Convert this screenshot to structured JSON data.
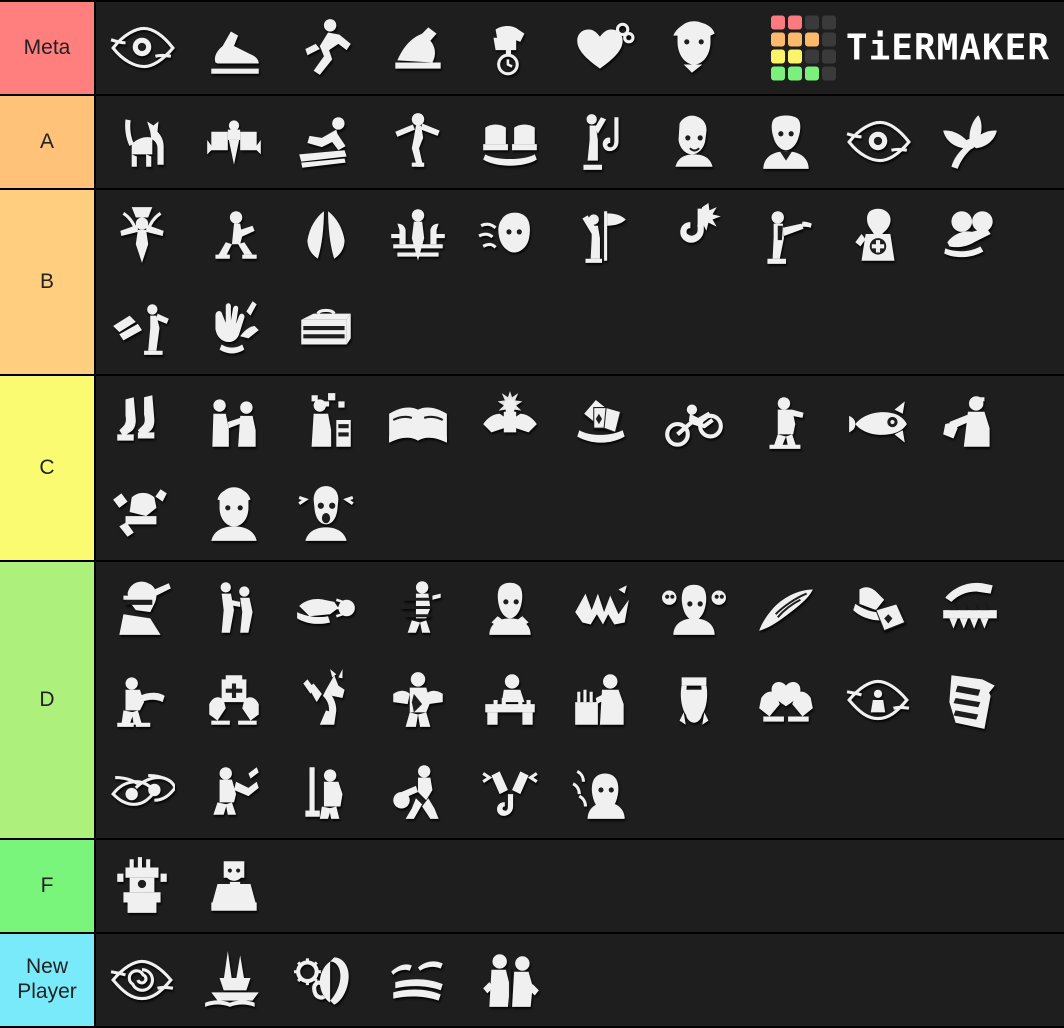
{
  "app": {
    "name": "TierMaker",
    "watermark_text": "TiERMAKER",
    "background_color": "#1a1a1a",
    "row_background_color": "#1e1e1e",
    "border_color": "#000000",
    "label_text_color": "#222222"
  },
  "logo": {
    "squares": [
      "#fa7a7f",
      "#fa7a7f",
      "#3a3a3a",
      "#3a3a3a",
      "#fbb96b",
      "#fbb96b",
      "#fbb96b",
      "#3a3a3a",
      "#fbf46b",
      "#fbf46b",
      "#3a3a3a",
      "#3a3a3a",
      "#7bf07b",
      "#7bf07b",
      "#7bf07b",
      "#3a3a3a"
    ]
  },
  "tiers": [
    {
      "label": "Meta",
      "color": "#ff7f7f",
      "items": [
        {
          "name": "object-of-obsession-perk",
          "icon": "eye-wide"
        },
        {
          "name": "lithe-perk",
          "icon": "sneakers"
        },
        {
          "name": "sprint-burst-perk",
          "icon": "runner"
        },
        {
          "name": "dead-hard-perk",
          "icon": "arm-flex"
        },
        {
          "name": "resilience-perk",
          "icon": "fist-stopwatch"
        },
        {
          "name": "deja-vu-perk",
          "icon": "heart-wire"
        },
        {
          "name": "borrowed-time-perk",
          "icon": "bearded-man"
        }
      ]
    },
    {
      "label": "A",
      "color": "#ffc278",
      "items": [
        {
          "name": "black-cat-perk",
          "icon": "cat"
        },
        {
          "name": "open-handed-perk",
          "icon": "winged-figure"
        },
        {
          "name": "balanced-landing-perk",
          "icon": "vaulting-runner"
        },
        {
          "name": "dance-with-me-perk",
          "icon": "dancer"
        },
        {
          "name": "breakout-perk",
          "icon": "two-fists"
        },
        {
          "name": "decisive-strike-perk",
          "icon": "hook-raise"
        },
        {
          "name": "kindred-perk",
          "icon": "woman-portrait"
        },
        {
          "name": "mettle-of-man-perk",
          "icon": "woman-bust"
        },
        {
          "name": "bond-perk",
          "icon": "eye-wide"
        },
        {
          "name": "botany-knowledge-perk",
          "icon": "plant-leaf"
        }
      ]
    },
    {
      "label": "B",
      "color": "#ffcf7f",
      "items": [
        {
          "name": "hex-ruin-counter-perk",
          "icon": "man-arms-out"
        },
        {
          "name": "urban-evasion-perk",
          "icon": "crouching-woman"
        },
        {
          "name": "wings-perk",
          "icon": "wings"
        },
        {
          "name": "leader-perk",
          "icon": "group-leader"
        },
        {
          "name": "calm-spirit-perk",
          "icon": "woman-wind"
        },
        {
          "name": "hope-flag-perk",
          "icon": "flag-bearer"
        },
        {
          "name": "saboteur-perk",
          "icon": "broken-hook"
        },
        {
          "name": "pointing-man-perk",
          "icon": "pointing-man"
        },
        {
          "name": "for-the-people-perk",
          "icon": "woman-jacket"
        },
        {
          "name": "self-care-perk",
          "icon": "hands-head"
        },
        {
          "name": "head-on-perk",
          "icon": "locker-stun"
        },
        {
          "name": "empathy-perk",
          "icon": "hands-torch"
        },
        {
          "name": "toolbox-perk",
          "icon": "toolbox"
        }
      ]
    },
    {
      "label": "C",
      "color": "#fbfb72",
      "items": [
        {
          "name": "lightweight-perk",
          "icon": "boots"
        },
        {
          "name": "prove-thyself-perk",
          "icon": "two-men-talk"
        },
        {
          "name": "technician-perk",
          "icon": "generator-worker"
        },
        {
          "name": "plunderers-instinct-perk",
          "icon": "open-book"
        },
        {
          "name": "adrenaline-perk",
          "icon": "flexing-arms"
        },
        {
          "name": "up-the-ante-perk",
          "icon": "playing-cards"
        },
        {
          "name": "fixated-perk",
          "icon": "motorbike"
        },
        {
          "name": "detectives-hunch-perk",
          "icon": "crouching-man"
        },
        {
          "name": "red-herring-perk",
          "icon": "fish"
        },
        {
          "name": "jeff-bag-perk",
          "icon": "man-with-bag"
        },
        {
          "name": "diversion-perk",
          "icon": "rock-throw"
        },
        {
          "name": "dwight-portrait-perk",
          "icon": "man-portrait"
        },
        {
          "name": "premonition-perk",
          "icon": "shocked-man"
        }
      ]
    },
    {
      "label": "D",
      "color": "#adf07c",
      "items": [
        {
          "name": "ace-in-the-hole-perk",
          "icon": "sunglasses-man"
        },
        {
          "name": "tag-team-perk",
          "icon": "two-figures"
        },
        {
          "name": "throw-rock-perk",
          "icon": "hand-throwing-rock"
        },
        {
          "name": "blast-mine-perk",
          "icon": "glitch-runner"
        },
        {
          "name": "scream-woman-perk",
          "icon": "woman-hands"
        },
        {
          "name": "graffiti-perk",
          "icon": "graffiti-tag"
        },
        {
          "name": "skull-girl-perk",
          "icon": "girl-skulls"
        },
        {
          "name": "quick-quiet-perk",
          "icon": "feather"
        },
        {
          "name": "left-behind-perk",
          "icon": "hand-cards"
        },
        {
          "name": "bear-trap-perk",
          "icon": "jaw-trap"
        },
        {
          "name": "no-one-left-behind-perk",
          "icon": "carry-survivor"
        },
        {
          "name": "medkit-perk",
          "icon": "hands-medkit"
        },
        {
          "name": "rearing-horse-perk",
          "icon": "horse"
        },
        {
          "name": "shirtless-man-perk",
          "icon": "strong-man"
        },
        {
          "name": "barricade-perk",
          "icon": "man-barricade"
        },
        {
          "name": "workbench-perk",
          "icon": "man-workbench"
        },
        {
          "name": "gloves-perk",
          "icon": "hanging-gloves"
        },
        {
          "name": "hands-heart-perk",
          "icon": "hands-heart"
        },
        {
          "name": "aura-eye-perk",
          "icon": "eye-figure"
        },
        {
          "name": "torn-poster-perk",
          "icon": "torn-page"
        },
        {
          "name": "nightmare-eyes-perk",
          "icon": "two-eyes"
        },
        {
          "name": "kneeling-survivor-perk",
          "icon": "kneeling-flash"
        },
        {
          "name": "pipe-man-perk",
          "icon": "man-with-pipe"
        },
        {
          "name": "running-bag-perk",
          "icon": "running-man-bag"
        },
        {
          "name": "firecrackers-perk",
          "icon": "firecracker-hook"
        },
        {
          "name": "woman-fire-perk",
          "icon": "woman-smoke"
        }
      ]
    },
    {
      "label": "F",
      "color": "#79f57c",
      "items": [
        {
          "name": "stone-gauntlet-perk",
          "icon": "tower-totem"
        },
        {
          "name": "man-reading-perk",
          "icon": "man-reading"
        }
      ]
    },
    {
      "label": "New Player",
      "color": "#79eaf9",
      "items": [
        {
          "name": "spiral-eye-perk",
          "icon": "spiral-eye"
        },
        {
          "name": "boat-perk",
          "icon": "boat"
        },
        {
          "name": "shh-gear-perk",
          "icon": "shush-gear"
        },
        {
          "name": "closed-eyes-perk",
          "icon": "sleeping-eyes"
        },
        {
          "name": "two-survivors-perk",
          "icon": "pair-back-to-back"
        }
      ]
    }
  ]
}
